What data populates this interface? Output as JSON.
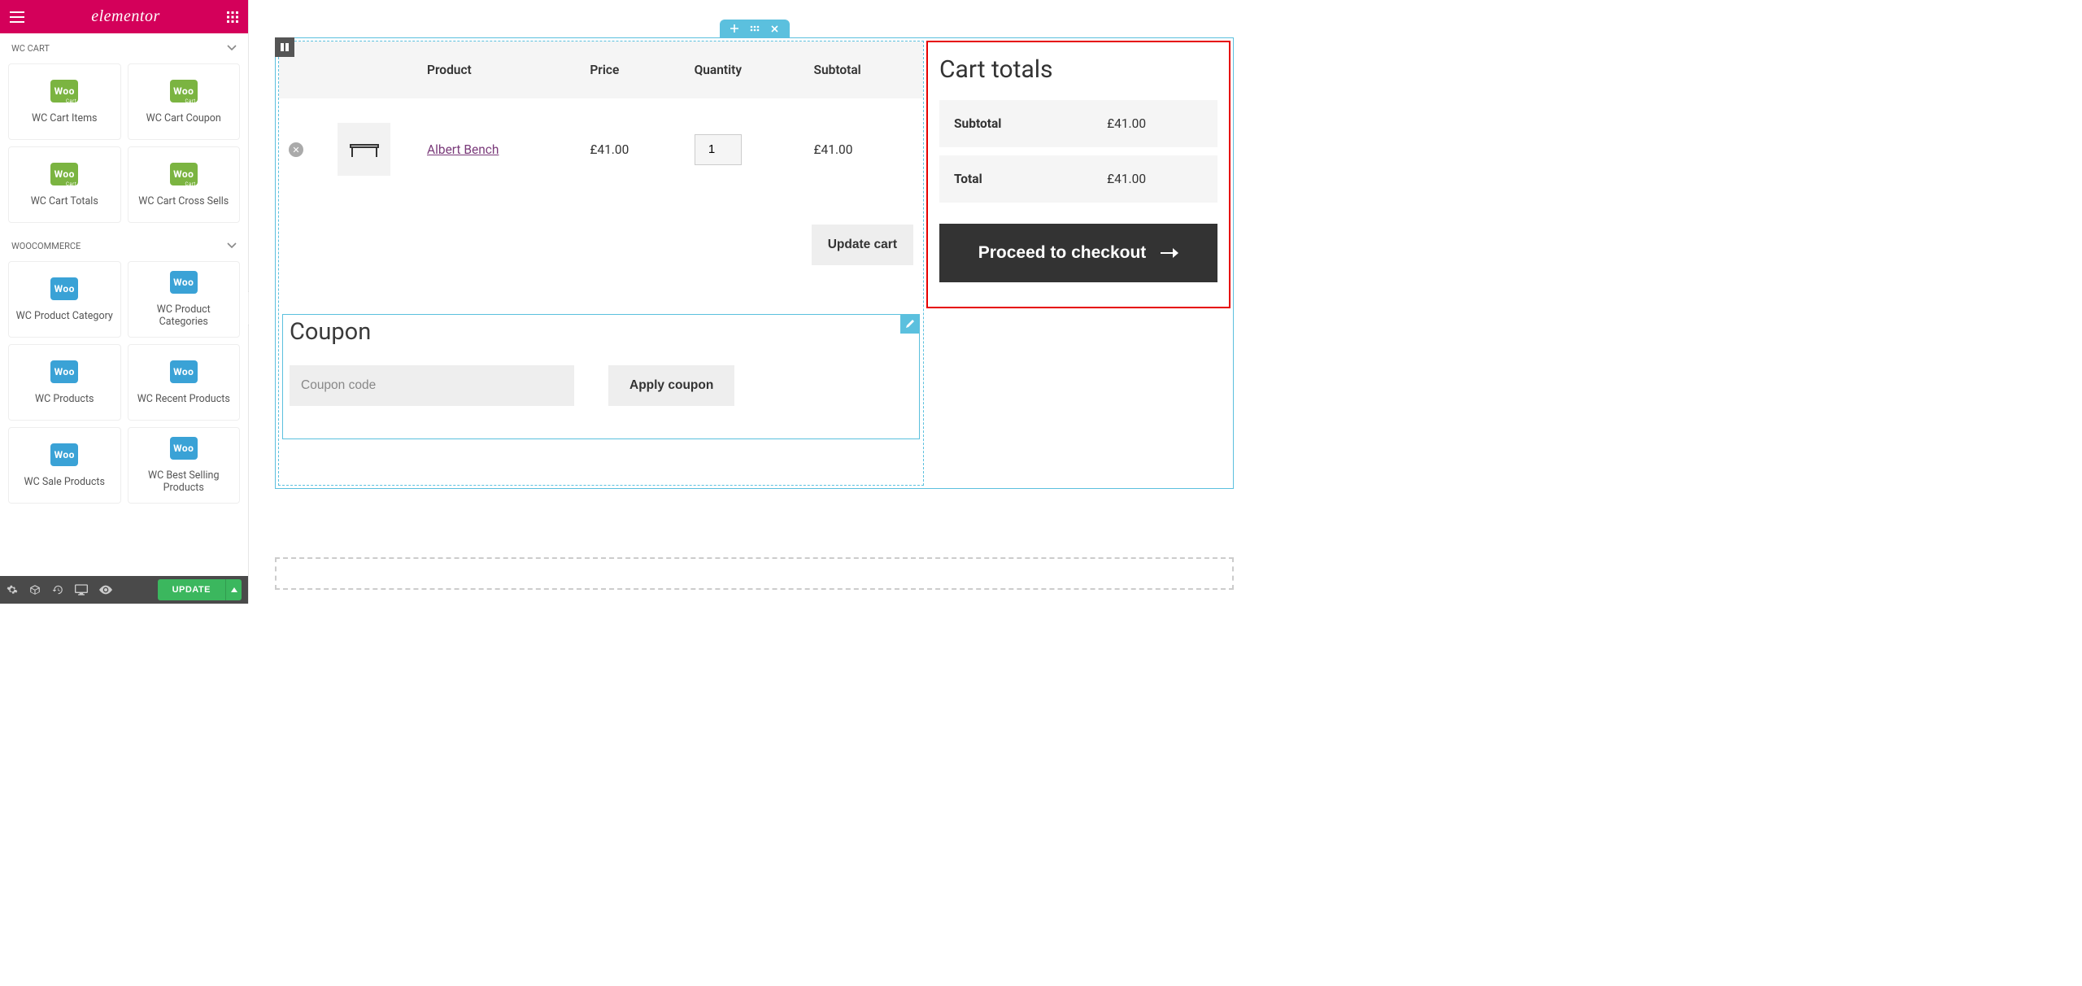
{
  "brand": "elementor",
  "sidebar": {
    "categories": [
      {
        "label": "WC CART"
      },
      {
        "label": "WOOCOMMERCE"
      }
    ],
    "wc_cart_widgets": [
      {
        "icon_text": "Woo",
        "icon_sub": "Cart",
        "color": "green",
        "label": "WC Cart Items"
      },
      {
        "icon_text": "Woo",
        "icon_sub": "Cart",
        "color": "green",
        "label": "WC Cart Coupon"
      },
      {
        "icon_text": "Woo",
        "icon_sub": "Cart",
        "color": "green",
        "label": "WC Cart Totals"
      },
      {
        "icon_text": "Woo",
        "icon_sub": "Cart",
        "color": "green",
        "label": "WC Cart Cross Sells"
      }
    ],
    "woo_widgets": [
      {
        "icon_text": "Woo",
        "color": "blue",
        "label": "WC Product Category"
      },
      {
        "icon_text": "Woo",
        "color": "blue",
        "label": "WC Product Categories"
      },
      {
        "icon_text": "Woo",
        "color": "blue",
        "label": "WC Products"
      },
      {
        "icon_text": "Woo",
        "color": "blue",
        "label": "WC Recent Products"
      },
      {
        "icon_text": "Woo",
        "color": "blue",
        "label": "WC Sale Products"
      },
      {
        "icon_text": "Woo",
        "color": "blue",
        "label": "WC Best Selling Products"
      }
    ]
  },
  "footer": {
    "update": "UPDATE"
  },
  "cart": {
    "headers": {
      "product": "Product",
      "price": "Price",
      "quantity": "Quantity",
      "subtotal": "Subtotal"
    },
    "item": {
      "name": "Albert Bench",
      "price": "£41.00",
      "qty": "1",
      "subtotal": "£41.00"
    },
    "update_button": "Update cart"
  },
  "coupon": {
    "title": "Coupon",
    "placeholder": "Coupon code",
    "apply": "Apply coupon"
  },
  "totals": {
    "title": "Cart totals",
    "subtotal_label": "Subtotal",
    "subtotal_value": "£41.00",
    "total_label": "Total",
    "total_value": "£41.00",
    "checkout": "Proceed to checkout"
  }
}
